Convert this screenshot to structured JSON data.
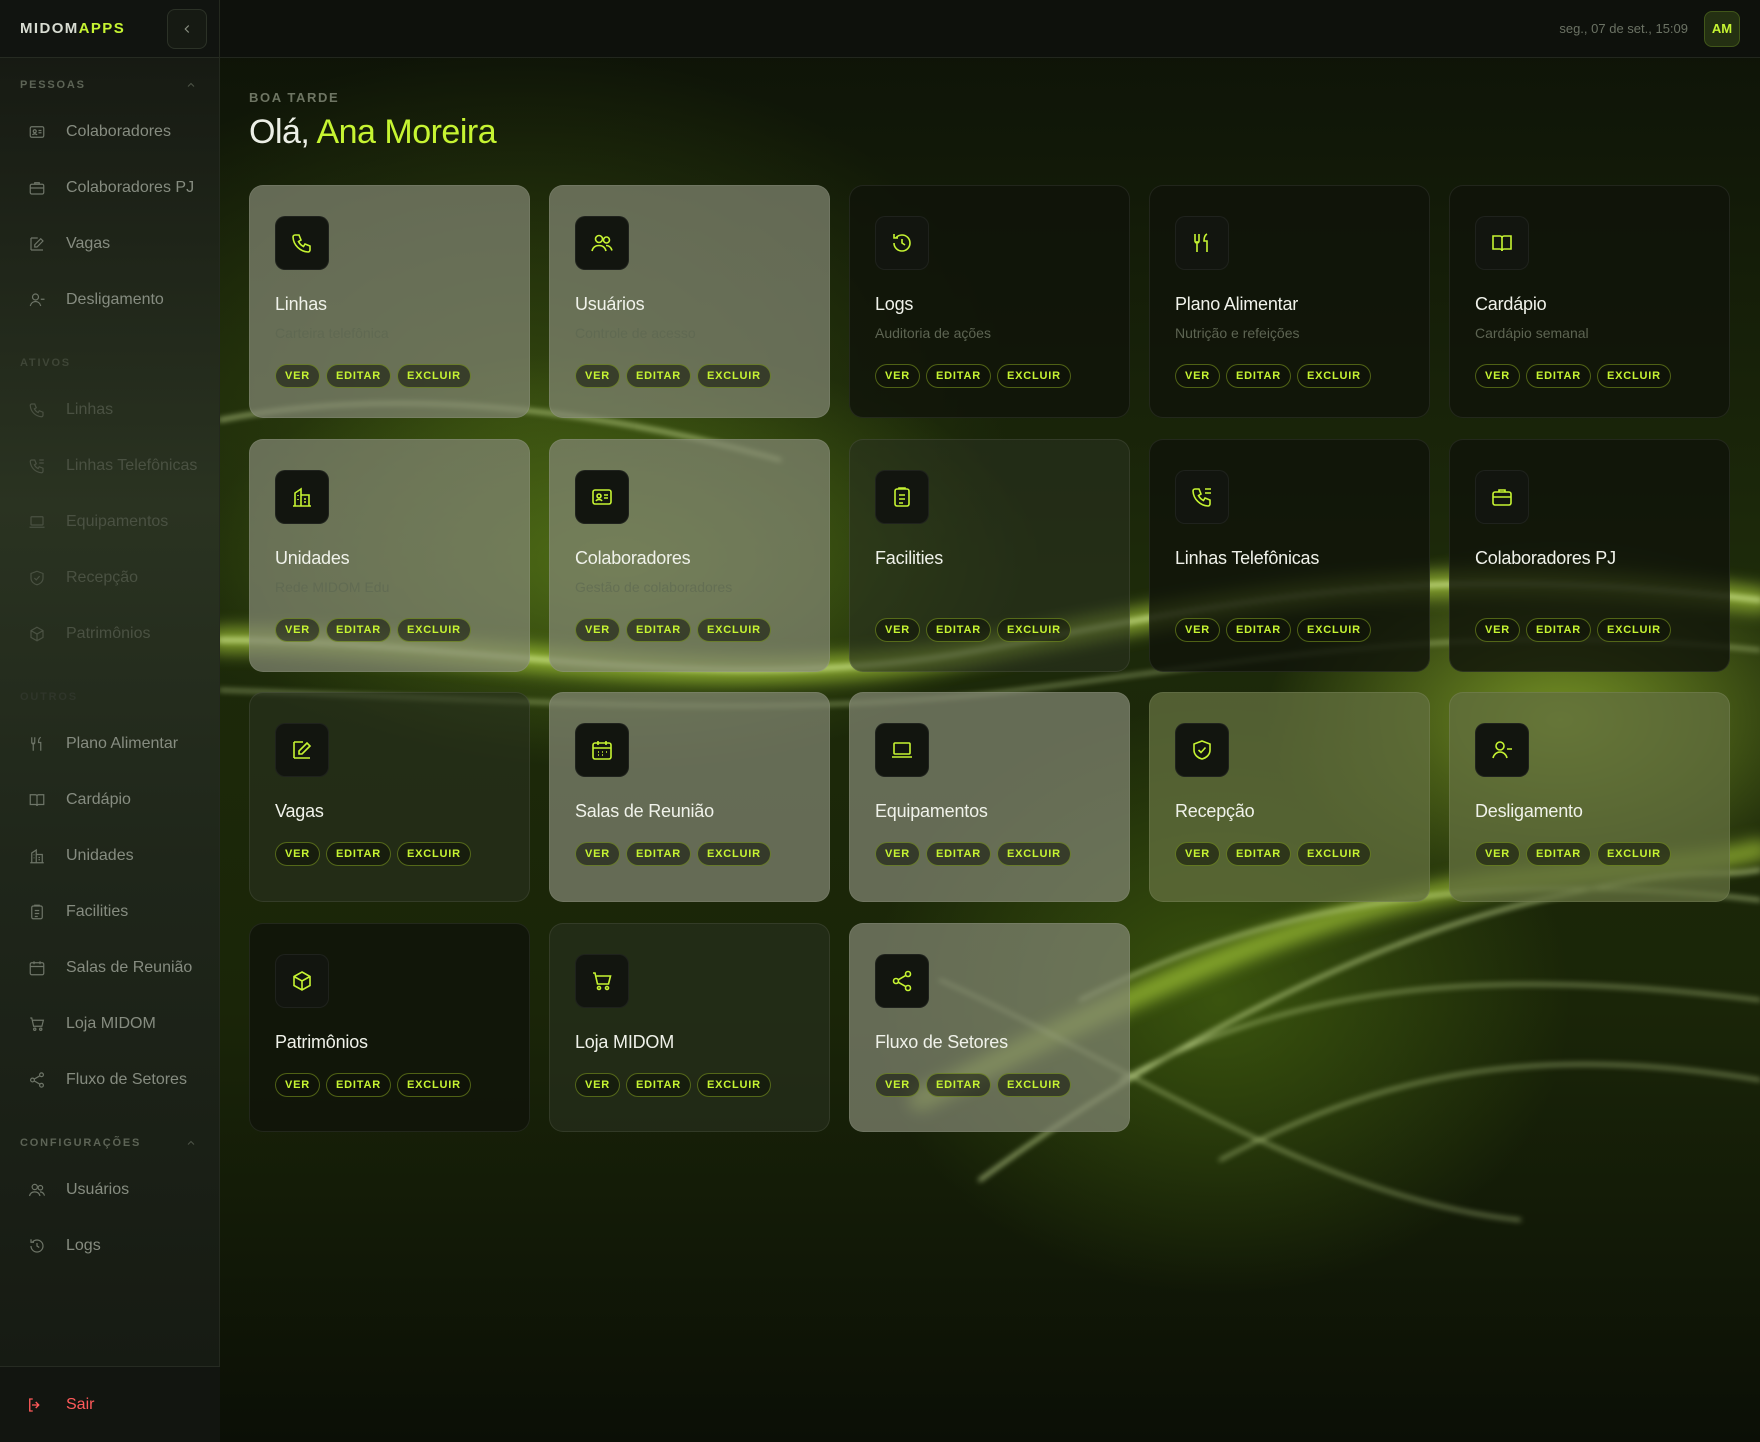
{
  "app": {
    "brand_prefix": "MIDOM",
    "brand_accent": "APPS",
    "accent_color": "#c6f432"
  },
  "topbar": {
    "datetime": "seg., 07 de set., 15:09",
    "avatar_initials": "AM"
  },
  "sidebar": {
    "sections": [
      {
        "title": "PESSOAS",
        "items": [
          {
            "label": "Colaboradores",
            "icon": "id-card-icon"
          },
          {
            "label": "Colaboradores PJ",
            "icon": "briefcase-icon"
          },
          {
            "label": "Vagas",
            "icon": "edit-icon"
          },
          {
            "label": "Desligamento",
            "icon": "user-minus-icon"
          }
        ]
      },
      {
        "title": "ATIVOS",
        "items": [
          {
            "label": "Linhas",
            "icon": "phone-icon"
          },
          {
            "label": "Linhas Telefônicas",
            "icon": "phone-list-icon"
          },
          {
            "label": "Equipamentos",
            "icon": "laptop-icon"
          },
          {
            "label": "Recepção",
            "icon": "shield-check-icon"
          },
          {
            "label": "Patrimônios",
            "icon": "package-icon"
          }
        ]
      },
      {
        "title": "OUTROS",
        "items": [
          {
            "label": "Plano Alimentar",
            "icon": "utensils-icon"
          },
          {
            "label": "Cardápio",
            "icon": "book-icon"
          },
          {
            "label": "Unidades",
            "icon": "building-icon"
          },
          {
            "label": "Facilities",
            "icon": "clipboard-icon"
          },
          {
            "label": "Salas de Reunião",
            "icon": "calendar-icon"
          },
          {
            "label": "Loja MIDOM",
            "icon": "cart-icon"
          },
          {
            "label": "Fluxo de Setores",
            "icon": "share-icon"
          }
        ]
      },
      {
        "title": "CONFIGURAÇÕES",
        "items": [
          {
            "label": "Usuários",
            "icon": "users-icon"
          },
          {
            "label": "Logs",
            "icon": "history-icon"
          }
        ]
      }
    ],
    "logout_label": "Sair"
  },
  "greeting": {
    "small": "BOA TARDE",
    "hello": "Olá,",
    "name": "Ana Moreira"
  },
  "actions": {
    "view": "VER",
    "edit": "EDITAR",
    "delete": "EXCLUIR"
  },
  "cards": [
    {
      "title": "Linhas",
      "subtitle": "Carteira telefônica",
      "icon": "phone-icon"
    },
    {
      "title": "Usuários",
      "subtitle": "Controle de acesso",
      "icon": "users-icon"
    },
    {
      "title": "Logs",
      "subtitle": "Auditoria de ações",
      "icon": "history-icon"
    },
    {
      "title": "Plano Alimentar",
      "subtitle": "Nutrição e refeições",
      "icon": "utensils-icon"
    },
    {
      "title": "Cardápio",
      "subtitle": "Cardápio semanal",
      "icon": "book-icon"
    },
    {
      "title": "Unidades",
      "subtitle": "Rede MIDOM Edu",
      "icon": "building-icon"
    },
    {
      "title": "Colaboradores",
      "subtitle": "Gestão de colaboradores",
      "icon": "id-card-icon"
    },
    {
      "title": "Facilities",
      "subtitle": "",
      "icon": "clipboard-icon"
    },
    {
      "title": "Linhas Telefônicas",
      "subtitle": "",
      "icon": "phone-list-icon"
    },
    {
      "title": "Colaboradores PJ",
      "subtitle": "",
      "icon": "briefcase-icon"
    },
    {
      "title": "Vagas",
      "subtitle": "",
      "icon": "edit-icon"
    },
    {
      "title": "Salas de Reunião",
      "subtitle": "",
      "icon": "calendar-icon"
    },
    {
      "title": "Equipamentos",
      "subtitle": "",
      "icon": "laptop-icon"
    },
    {
      "title": "Recepção",
      "subtitle": "",
      "icon": "shield-check-icon"
    },
    {
      "title": "Desligamento",
      "subtitle": "",
      "icon": "user-minus-icon"
    },
    {
      "title": "Patrimônios",
      "subtitle": "",
      "icon": "package-icon"
    },
    {
      "title": "Loja MIDOM",
      "subtitle": "",
      "icon": "cart-icon"
    },
    {
      "title": "Fluxo de Setores",
      "subtitle": "",
      "icon": "share-icon"
    }
  ]
}
